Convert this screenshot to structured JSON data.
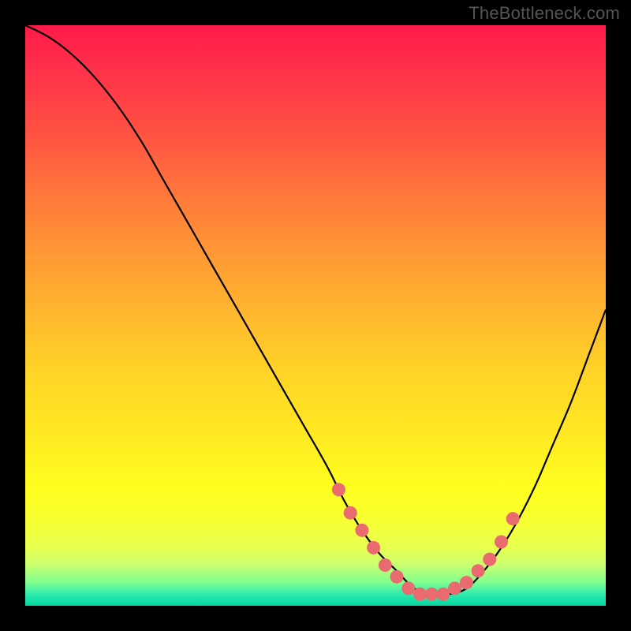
{
  "watermark": "TheBottleneck.com",
  "chart_data": {
    "type": "line",
    "title": "",
    "xlabel": "",
    "ylabel": "",
    "xlim": [
      0,
      100
    ],
    "ylim": [
      0,
      100
    ],
    "series": [
      {
        "name": "bottleneck-curve",
        "x": [
          0,
          4,
          8,
          12,
          16,
          20,
          24,
          28,
          32,
          36,
          40,
          44,
          48,
          52,
          55,
          58,
          61,
          64,
          67,
          70,
          73,
          76,
          79,
          82,
          85,
          88,
          91,
          94,
          97,
          100
        ],
        "y": [
          100,
          98,
          95,
          91,
          86,
          80,
          73,
          66,
          59,
          52,
          45,
          38,
          31,
          24,
          18,
          13,
          9,
          6,
          3,
          2,
          2,
          3,
          6,
          10,
          15,
          21,
          28,
          35,
          43,
          51
        ]
      }
    ],
    "markers": {
      "name": "highlighted-range",
      "x": [
        54,
        56,
        58,
        60,
        62,
        64,
        66,
        68,
        70,
        72,
        74,
        76,
        78,
        80,
        82,
        84
      ],
      "y": [
        20,
        16,
        13,
        10,
        7,
        5,
        3,
        2,
        2,
        2,
        3,
        4,
        6,
        8,
        11,
        15
      ],
      "color": "#e96a6f"
    }
  }
}
